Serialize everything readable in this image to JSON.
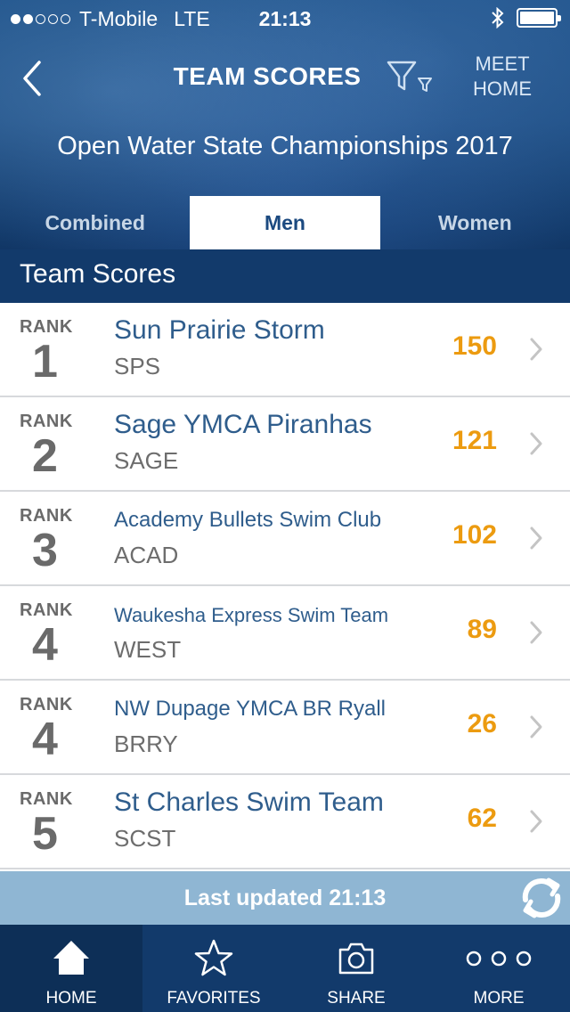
{
  "status_bar": {
    "carrier": "T-Mobile",
    "network": "LTE",
    "time": "21:13"
  },
  "nav": {
    "title": "TEAM SCORES",
    "meet_home_line1": "MEET",
    "meet_home_line2": "HOME"
  },
  "meet": {
    "title": "Open Water State Championships 2017"
  },
  "tabs": [
    {
      "label": "Combined",
      "active": false
    },
    {
      "label": "Men",
      "active": true
    },
    {
      "label": "Women",
      "active": false
    }
  ],
  "section_title": "Team Scores",
  "rank_label": "RANK",
  "teams": [
    {
      "rank": "1",
      "name": "Sun Prairie Storm",
      "code": "SPS",
      "score": "150"
    },
    {
      "rank": "2",
      "name": "Sage YMCA Piranhas",
      "code": "SAGE",
      "score": "121"
    },
    {
      "rank": "3",
      "name": "Academy Bullets Swim Club",
      "code": "ACAD",
      "score": "102"
    },
    {
      "rank": "4",
      "name": "Waukesha Express Swim Team",
      "code": "WEST",
      "score": "89"
    },
    {
      "rank": "4",
      "name": "NW Dupage YMCA BR Ryall",
      "code": "BRRY",
      "score": "26"
    },
    {
      "rank": "5",
      "name": "St Charles Swim Team",
      "code": "SCST",
      "score": "62"
    }
  ],
  "updated": "Last updated 21:13",
  "tabbar": [
    {
      "label": "HOME",
      "icon": "home-icon"
    },
    {
      "label": "FAVORITES",
      "icon": "star-icon"
    },
    {
      "label": "SHARE",
      "icon": "camera-icon"
    },
    {
      "label": "MORE",
      "icon": "more-icon"
    }
  ],
  "colors": {
    "primary": "#123a6b",
    "team_name": "#2f5d8c",
    "score": "#ec9b10",
    "updated_bar": "#8fb6d3"
  }
}
